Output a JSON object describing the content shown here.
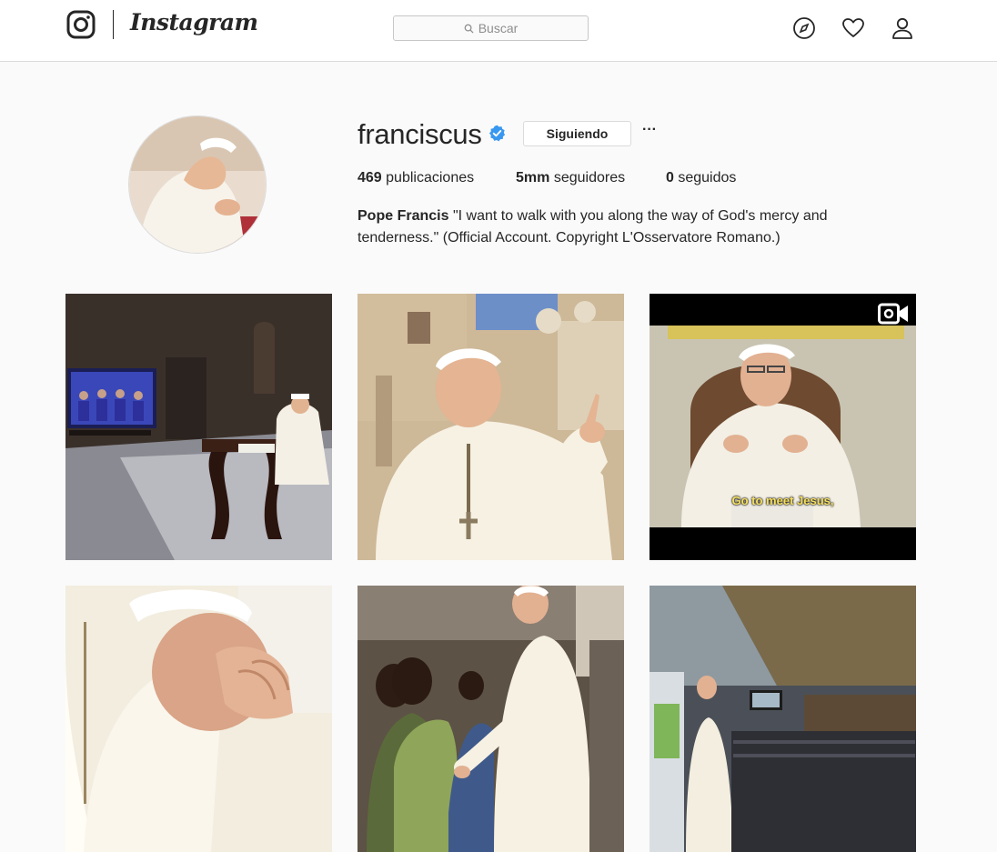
{
  "nav": {
    "brand": "Instagram",
    "search_placeholder": "Buscar",
    "icons": [
      "camera-logo-icon",
      "compass-icon",
      "heart-icon",
      "person-icon"
    ]
  },
  "profile": {
    "username": "franciscus",
    "verified": true,
    "follow_button": "Siguiendo",
    "more_button": "···",
    "stats": [
      {
        "value": "469",
        "label": "publicaciones"
      },
      {
        "value": "5mm",
        "label": "seguidores"
      },
      {
        "value": "0",
        "label": "seguidos"
      }
    ],
    "full_name": "Pope Francis",
    "bio": "\"I want to walk with you along the way of God's mercy and tenderness.\" (Official Account. Copyright L'Osservatore Romano.)"
  },
  "posts": [
    {
      "kind": "photo"
    },
    {
      "kind": "photo"
    },
    {
      "kind": "video",
      "caption": "Go to meet Jesus,"
    },
    {
      "kind": "photo"
    },
    {
      "kind": "photo"
    },
    {
      "kind": "photo"
    }
  ],
  "colors": {
    "background": "#fafafa",
    "border": "#dbdbdb",
    "text": "#262626",
    "muted": "#8e8e8e",
    "verified_blue": "#3897f0"
  }
}
